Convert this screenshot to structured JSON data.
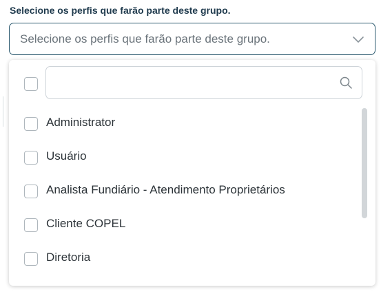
{
  "field": {
    "label": "Selecione os perfis que farão parte deste grupo.",
    "placeholder": "Selecione os perfis que farão parte deste grupo."
  },
  "dropdown": {
    "search_value": "",
    "options": [
      {
        "label": "Administrator",
        "checked": false
      },
      {
        "label": "Usuário",
        "checked": false
      },
      {
        "label": "Analista Fundiário - Atendimento Proprietários",
        "checked": false
      },
      {
        "label": "Cliente COPEL",
        "checked": false
      },
      {
        "label": "Diretoria",
        "checked": false
      }
    ]
  },
  "icons": {
    "select": "chevron-down-icon",
    "search": "search-icon"
  },
  "colors": {
    "label": "#1f3a4d",
    "select_border": "#2c5a6f",
    "placeholder": "#6b747b",
    "checkbox_border": "#aeb6bc",
    "scrollbar": "#d2d6d9"
  }
}
